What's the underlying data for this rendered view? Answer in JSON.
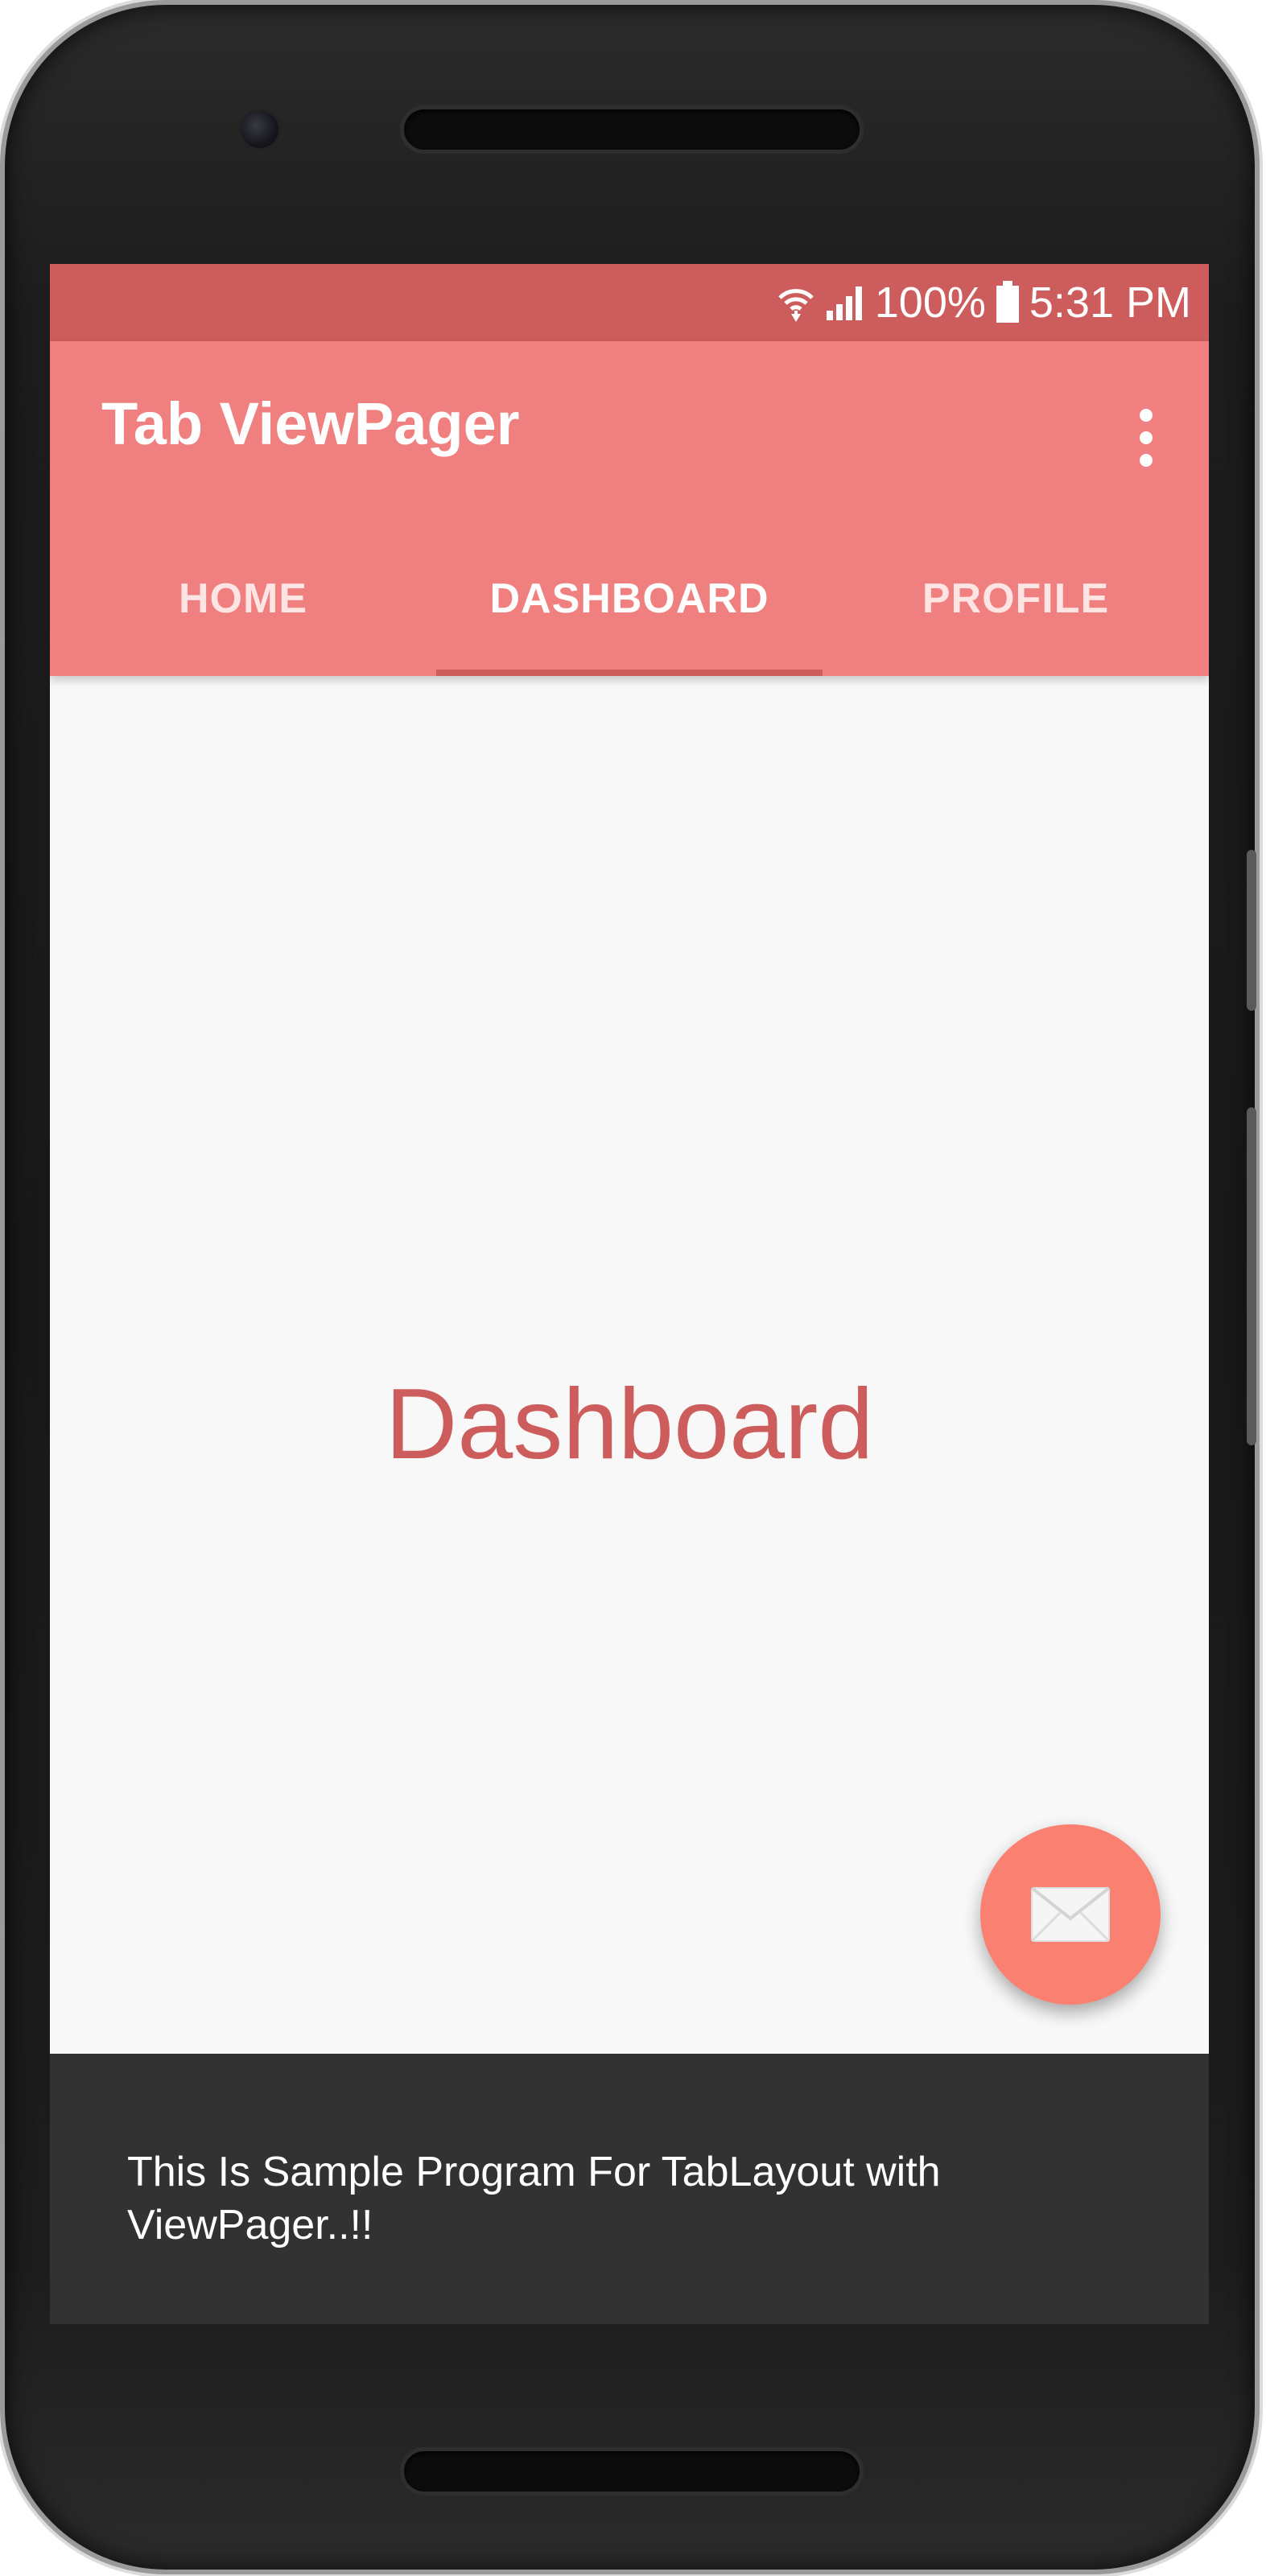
{
  "status_bar": {
    "battery": "100%",
    "time": "5:31 PM",
    "icons": [
      "wifi-icon",
      "cell-signal-icon",
      "battery-icon"
    ]
  },
  "app_bar": {
    "title": "Tab ViewPager",
    "menu_icon": "more-vert-icon"
  },
  "tabs": [
    {
      "label": "HOME",
      "selected": false
    },
    {
      "label": "DASHBOARD",
      "selected": true
    },
    {
      "label": "PROFILE",
      "selected": false
    }
  ],
  "content": {
    "title": "Dashboard"
  },
  "fab": {
    "icon": "mail-envelope-icon"
  },
  "snackbar": {
    "message": "This Is Sample Program For TabLayout with ViewPager..!!"
  },
  "colors": {
    "primary": "#f08080",
    "primary_dark": "#cd5c5c",
    "accent": "#fa8072",
    "background": "#f8f8f8",
    "snackbar": "#323232"
  }
}
